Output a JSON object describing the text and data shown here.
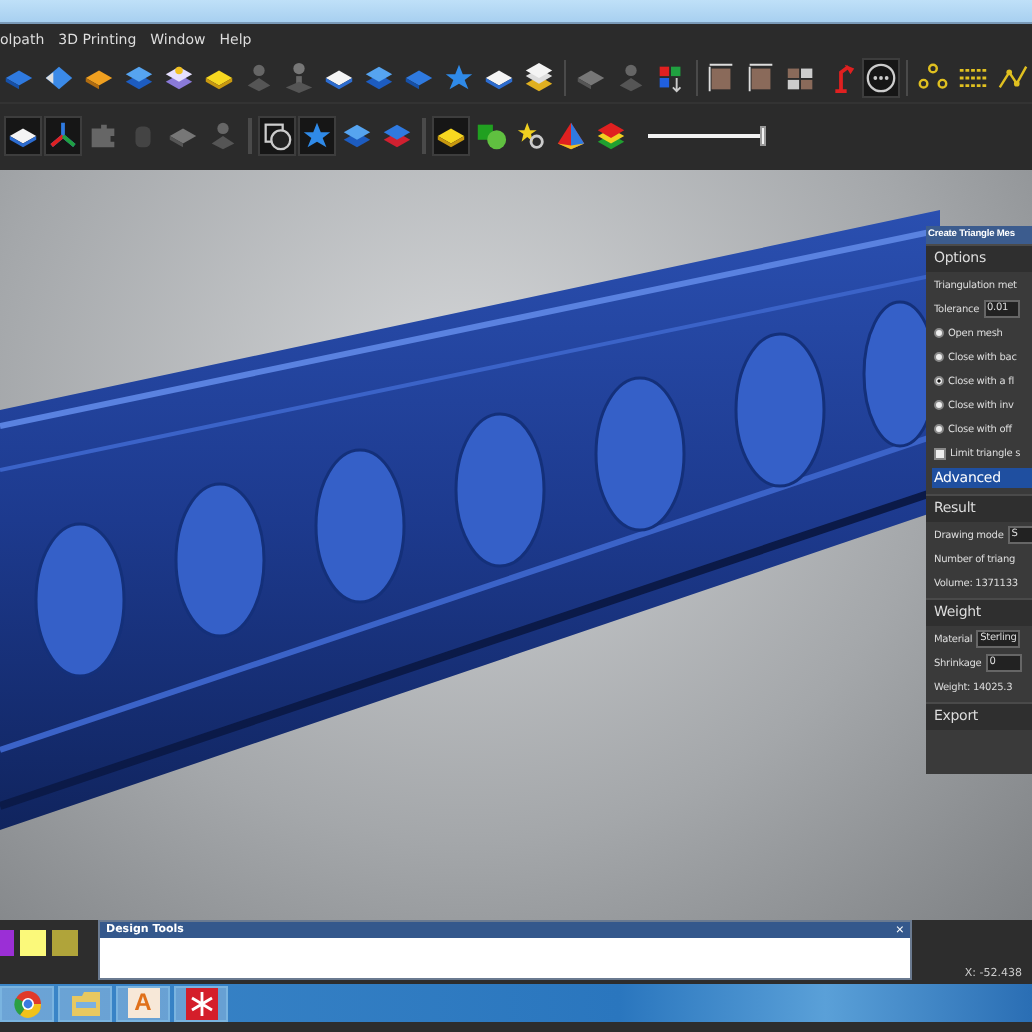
{
  "menu": [
    {
      "label": "olpath"
    },
    {
      "label": "3D Printing"
    },
    {
      "label": "Window"
    },
    {
      "label": "Help"
    }
  ],
  "toolbar_top": [
    {
      "kind": "diamond-blue",
      "pressed": false
    },
    {
      "kind": "arrow-blue",
      "pressed": false
    },
    {
      "kind": "diamond-orange",
      "pressed": false
    },
    {
      "kind": "stack-blue",
      "pressed": false
    },
    {
      "kind": "stack-purple",
      "pressed": false
    },
    {
      "kind": "diamond-yellow",
      "pressed": false
    },
    {
      "kind": "figure-gray",
      "pressed": false
    },
    {
      "kind": "pin-gray",
      "pressed": false
    },
    {
      "kind": "diamond-white",
      "pressed": false
    },
    {
      "kind": "stack-blue",
      "pressed": false
    },
    {
      "kind": "diamond-blue",
      "pressed": false
    },
    {
      "kind": "star-blue",
      "pressed": false
    },
    {
      "kind": "diamond-white",
      "pressed": false
    },
    {
      "kind": "stack-yellow",
      "pressed": false
    },
    {
      "kind": "separator"
    },
    {
      "kind": "diamond-gray",
      "pressed": false
    },
    {
      "kind": "figure-gray",
      "pressed": false
    },
    {
      "kind": "grid-color",
      "pressed": false
    },
    {
      "kind": "separator"
    },
    {
      "kind": "frame-brown",
      "pressed": false
    },
    {
      "kind": "frame-brown",
      "pressed": false
    },
    {
      "kind": "grid-brown",
      "pressed": false
    },
    {
      "kind": "lamp-red",
      "pressed": false
    },
    {
      "kind": "circle-dots",
      "pressed": true
    },
    {
      "kind": "separator"
    },
    {
      "kind": "nodes-yellow",
      "pressed": false
    },
    {
      "kind": "lines-yellow",
      "pressed": false
    },
    {
      "kind": "graph-yellow",
      "pressed": false
    }
  ],
  "toolbar_bottom": [
    {
      "kind": "diamond-white",
      "pressed": true
    },
    {
      "kind": "axes",
      "pressed": true
    },
    {
      "kind": "puzzle-gray",
      "pressed": false
    },
    {
      "kind": "cylinder-gray",
      "pressed": false
    },
    {
      "kind": "diamond-gray",
      "pressed": false
    },
    {
      "kind": "figure-gray",
      "pressed": false
    },
    {
      "kind": "separator"
    },
    {
      "kind": "circle-square",
      "pressed": true
    },
    {
      "kind": "star-blue",
      "pressed": true
    },
    {
      "kind": "stack-blue",
      "pressed": false
    },
    {
      "kind": "stack-red",
      "pressed": false
    },
    {
      "kind": "separator"
    },
    {
      "kind": "diamond-yellow",
      "pressed": true
    },
    {
      "kind": "shapes-green",
      "pressed": false
    },
    {
      "kind": "star-yellow",
      "pressed": false
    },
    {
      "kind": "pyramid",
      "pressed": false
    },
    {
      "kind": "stack-rainbow",
      "pressed": false
    }
  ],
  "zoom_slider": {
    "level": 1
  },
  "panel": {
    "title": "Create Triangle Mes",
    "sections": [
      {
        "header": "Options",
        "items": [
          {
            "kind": "text",
            "label": "Triangulation met"
          },
          {
            "kind": "field",
            "label": "Tolerance",
            "value": "0.01"
          },
          {
            "kind": "radio",
            "label": "Open mesh",
            "selected": false
          },
          {
            "kind": "radio",
            "label": "Close with bac",
            "selected": false
          },
          {
            "kind": "radio",
            "label": "Close with a fl",
            "selected": true
          },
          {
            "kind": "radio",
            "label": "Close with inv",
            "selected": false
          },
          {
            "kind": "radio",
            "label": "Close with off",
            "selected": false
          },
          {
            "kind": "checkbox",
            "label": "Limit triangle s",
            "checked": false
          },
          {
            "kind": "bar",
            "label": "Advanced"
          }
        ]
      },
      {
        "header": "Result",
        "items": [
          {
            "kind": "field",
            "label": "Drawing mode",
            "value": "S"
          },
          {
            "kind": "text",
            "label": "Number of triang"
          },
          {
            "kind": "text",
            "label": "Volume: 1371133"
          }
        ]
      },
      {
        "header": "Weight",
        "items": [
          {
            "kind": "field",
            "label": "Material",
            "value": "Sterling"
          },
          {
            "kind": "field",
            "label": "Shrinkage",
            "value": "0"
          },
          {
            "kind": "text",
            "label": "Weight: 14025.3"
          }
        ]
      },
      {
        "header": "Export"
      }
    ]
  },
  "swatches": [
    {
      "color": "#9b2fd6"
    },
    {
      "color": "#fbf97a"
    },
    {
      "color": "#b0a43a"
    }
  ],
  "design_tools": {
    "title": "Design Tools",
    "close": "×"
  },
  "status": {
    "coordinate": "X: -52.438"
  },
  "taskbar": [
    {
      "kind": "browser"
    },
    {
      "kind": "folder"
    },
    {
      "kind": "letter",
      "label": "A"
    },
    {
      "kind": "snowflake"
    }
  ]
}
